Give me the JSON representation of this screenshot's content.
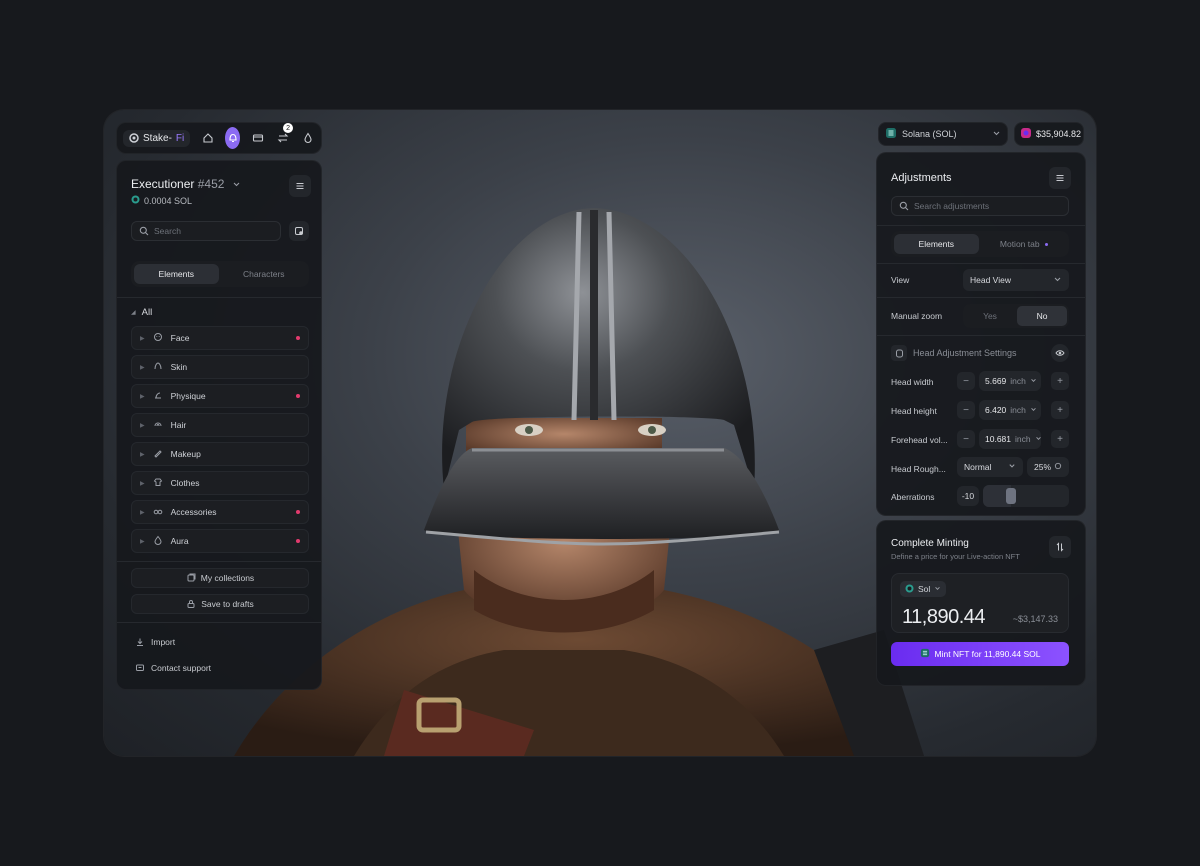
{
  "colors": {
    "accent": "#8b6bf2",
    "dot": "#e23a6d",
    "mint_button": "#7a3df5"
  },
  "topnav": {
    "logo_prefix": "Stake-",
    "logo_suffix": "Fi",
    "badge": "2"
  },
  "wallet": {
    "network": "Solana (SOL)",
    "balance": "$35,904.82"
  },
  "left": {
    "title": "Executioner",
    "title_num": "#452",
    "price": "0.0004 SOL",
    "search_placeholder": "Search",
    "tabs": [
      "Elements",
      "Characters"
    ],
    "all_label": "All",
    "categories": [
      {
        "label": "Face",
        "icon": "face-icon",
        "dot": true
      },
      {
        "label": "Skin",
        "icon": "skin-icon",
        "dot": false
      },
      {
        "label": "Physique",
        "icon": "physique-icon",
        "dot": true
      },
      {
        "label": "Hair",
        "icon": "hair-icon",
        "dot": false
      },
      {
        "label": "Makeup",
        "icon": "makeup-icon",
        "dot": false
      },
      {
        "label": "Clothes",
        "icon": "clothes-icon",
        "dot": false
      },
      {
        "label": "Accessories",
        "icon": "accessories-icon",
        "dot": true
      },
      {
        "label": "Aura",
        "icon": "aura-icon",
        "dot": true
      }
    ],
    "collections": "My collections",
    "drafts": "Save to drafts",
    "import": "Import",
    "support": "Contact support"
  },
  "adjust": {
    "title": "Adjustments",
    "search_placeholder": "Search adjustments",
    "tabs": [
      "Elements",
      "Motion tab"
    ],
    "view_label": "View",
    "view_value": "Head View",
    "zoom_label": "Manual zoom",
    "zoom_yes": "Yes",
    "zoom_no": "No",
    "settings_title": "Head Adjustment Settings",
    "head_width": {
      "label": "Head width",
      "value": "5.669",
      "unit": "inch"
    },
    "head_height": {
      "label": "Head height",
      "value": "6.420",
      "unit": "inch"
    },
    "forehead": {
      "label": "Forehead vol...",
      "value": "10.681",
      "unit": "inch"
    },
    "rough": {
      "label": "Head Rough...",
      "mode": "Normal",
      "percent": "25%"
    },
    "aberrations": {
      "label": "Aberrations",
      "value": "-10",
      "level": 0.3
    }
  },
  "mint": {
    "title": "Complete Minting",
    "desc": "Define a price for your Live-action NFT",
    "currency": "Sol",
    "amount": "11,890.44",
    "usd": "~$3,147.33",
    "button": "Mint NFT for 11,890.44 SOL"
  }
}
